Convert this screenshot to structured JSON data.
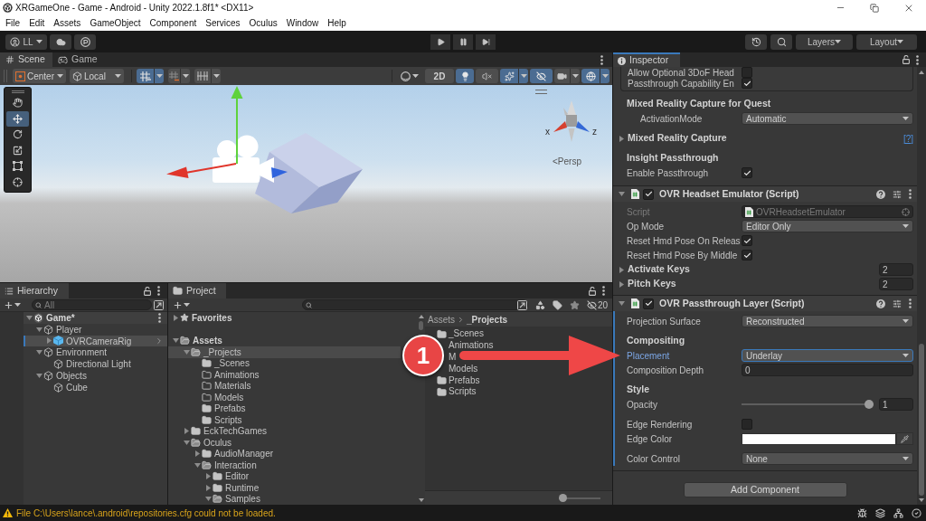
{
  "window": {
    "title": "XRGameOne - Game - Android - Unity 2022.1.8f1* <DX11>"
  },
  "menu": [
    "File",
    "Edit",
    "Assets",
    "GameObject",
    "Component",
    "Services",
    "Oculus",
    "Window",
    "Help"
  ],
  "toolbar": {
    "account": "LL",
    "layers": "Layers",
    "layout": "Layout"
  },
  "scene": {
    "tabs": [
      {
        "label": "Scene",
        "kind": "scene",
        "selected": true
      },
      {
        "label": "Game",
        "kind": "game",
        "selected": false
      }
    ],
    "pivot": "Center",
    "space": "Local",
    "snap_toggles": [
      {
        "kind": "snap",
        "on": true
      },
      {
        "kind": "increment",
        "on": false
      },
      {
        "kind": "grid",
        "on": false
      }
    ],
    "view_toggles": [
      {
        "kind": "dimension",
        "label": "2D",
        "on": false
      },
      {
        "kind": "lighting",
        "on": true
      },
      {
        "kind": "audio",
        "on": false
      },
      {
        "kind": "effects",
        "on": true
      },
      {
        "kind": "visibility",
        "on": true
      },
      {
        "kind": "camera",
        "on": false
      },
      {
        "kind": "gizmos",
        "on": true
      }
    ],
    "tools": [
      {
        "kind": "hand",
        "selected": false
      },
      {
        "kind": "move",
        "selected": true
      },
      {
        "kind": "rotate",
        "selected": false
      },
      {
        "kind": "scale",
        "selected": false
      },
      {
        "kind": "rect",
        "selected": false
      },
      {
        "kind": "transform",
        "selected": false
      }
    ],
    "axis_labels": [
      "x",
      "z"
    ],
    "projection": "<Persp"
  },
  "hierarchy": {
    "title": "Hierarchy",
    "search": {
      "placeholder": "All"
    },
    "tree": [
      {
        "label": "Game*",
        "kind": "scene",
        "expanded": true,
        "selected": false,
        "children": [
          {
            "label": "Player",
            "kind": "object",
            "expanded": true,
            "selected": false,
            "children": [
              {
                "label": "OVRCameraRig",
                "kind": "prefab",
                "expanded": false,
                "selected": true
              }
            ]
          },
          {
            "label": "Environment",
            "kind": "object",
            "expanded": true,
            "selected": false,
            "children": [
              {
                "label": "Directional Light",
                "kind": "object",
                "selected": false
              }
            ]
          },
          {
            "label": "Objects",
            "kind": "object",
            "expanded": true,
            "selected": false,
            "children": [
              {
                "label": "Cube",
                "kind": "object",
                "selected": false
              }
            ]
          }
        ]
      }
    ]
  },
  "project": {
    "title": "Project",
    "hidden_count": "20",
    "tree": [
      {
        "label": "Favorites",
        "kind": "favorites",
        "expanded": false,
        "selected": false
      },
      {
        "label": "Assets",
        "kind": "open_folder",
        "expanded": true,
        "selected": false,
        "children": [
          {
            "label": "_Projects",
            "kind": "open_folder",
            "expanded": true,
            "selected": true,
            "children": [
              {
                "label": "_Scenes",
                "kind": "folder",
                "selected": false
              },
              {
                "label": "Animations",
                "kind": "empty_folder",
                "selected": false
              },
              {
                "label": "Materials",
                "kind": "empty_folder",
                "selected": false
              },
              {
                "label": "Models",
                "kind": "empty_folder",
                "selected": false
              },
              {
                "label": "Prefabs",
                "kind": "folder",
                "selected": false
              },
              {
                "label": "Scripts",
                "kind": "folder",
                "selected": false
              }
            ]
          },
          {
            "label": "EckTechGames",
            "kind": "folder",
            "expanded": false,
            "selected": false
          },
          {
            "label": "Oculus",
            "kind": "open_folder",
            "expanded": true,
            "selected": false,
            "children": [
              {
                "label": "AudioManager",
                "kind": "folder",
                "expanded": false,
                "selected": false
              },
              {
                "label": "Interaction",
                "kind": "open_folder",
                "expanded": true,
                "selected": false,
                "children": [
                  {
                    "label": "Editor",
                    "kind": "folder",
                    "expanded": false,
                    "selected": false
                  },
                  {
                    "label": "Runtime",
                    "kind": "folder",
                    "expanded": false,
                    "selected": false
                  },
                  {
                    "label": "Samples",
                    "kind": "open_folder",
                    "expanded": true,
                    "selected": false
                  }
                ]
              }
            ]
          }
        ]
      }
    ],
    "breadcrumb": [
      "Assets",
      "_Projects"
    ],
    "items": [
      {
        "label": "_Scenes",
        "kind": "folder"
      },
      {
        "label": "Animations",
        "kind": "covered"
      },
      {
        "label": "M",
        "kind": "covered"
      },
      {
        "label": "Models",
        "kind": "covered"
      },
      {
        "label": "Prefabs",
        "kind": "folder"
      },
      {
        "label": "Scripts",
        "kind": "folder"
      }
    ],
    "icon_size": {
      "level": 0
    }
  },
  "inspector": {
    "title": "Inspector",
    "focused": true,
    "box_rows": [
      {
        "kind": "checkbox",
        "label": "Allow Optional 3DoF Head",
        "checked": false
      },
      {
        "kind": "checkbox",
        "label": "Passthrough Capability En",
        "checked": true
      }
    ],
    "sections": [
      {
        "heading": "Mixed Reality Capture for Quest",
        "children": [
          {
            "kind": "dropdown",
            "label": "ActivationMode",
            "value": "Automatic",
            "focused": false
          }
        ]
      },
      {
        "rows": [
          {
            "kind": "foldout",
            "label": "Mixed Reality Capture",
            "expanded": false,
            "help": "[?]"
          }
        ]
      },
      {
        "heading": "Insight Passthrough",
        "rows": [
          {
            "kind": "checkbox",
            "label": "Enable Passthrough",
            "checked": true
          }
        ]
      }
    ],
    "components": [
      {
        "title": "OVR Headset Emulator (Script)",
        "enabled": true,
        "expanded": true,
        "selected": false,
        "sections": [
          {
            "rows": [
              {
                "kind": "object",
                "label": "Script",
                "value": "OVRHeadsetEmulator",
                "disabled": true
              },
              {
                "kind": "dropdown",
                "label": "Op Mode",
                "value": "Editor Only",
                "focused": false
              },
              {
                "kind": "checkbox",
                "label": "Reset Hmd Pose On Releas",
                "checked": true
              },
              {
                "kind": "checkbox",
                "label": "Reset Hmd Pose By Middle",
                "checked": true
              },
              {
                "kind": "foldout",
                "label": "Activate Keys",
                "expanded": false,
                "value": "2"
              },
              {
                "kind": "foldout",
                "label": "Pitch Keys",
                "expanded": false,
                "value": "2"
              }
            ]
          }
        ]
      },
      {
        "title": "OVR Passthrough Layer (Script)",
        "enabled": true,
        "expanded": true,
        "selected": true,
        "sections": [
          {
            "rows": [
              {
                "kind": "dropdown",
                "label": "Projection Surface",
                "value": "Reconstructed",
                "focused": false
              }
            ]
          },
          {
            "heading": "Compositing",
            "rows": [
              {
                "kind": "dropdown",
                "label": "Placement",
                "value": "Underlay",
                "focused": true
              },
              {
                "kind": "number",
                "label": "Composition Depth",
                "value": "0"
              }
            ]
          },
          {
            "heading": "Style",
            "rows": [
              {
                "kind": "slider",
                "label": "Opacity",
                "level": 1,
                "value": "1"
              }
            ]
          },
          {
            "rows": [
              {
                "kind": "checkbox",
                "label": "Edge Rendering",
                "checked": false
              },
              {
                "kind": "color",
                "label": "Edge Color",
                "color": "#ffffff"
              }
            ]
          },
          {
            "rows": [
              {
                "kind": "dropdown",
                "label": "Color Control",
                "value": "None",
                "focused": false
              }
            ]
          }
        ]
      }
    ],
    "add_button": "Add Component"
  },
  "annotation": {
    "label": "1"
  },
  "status": {
    "message": "File C:\\Users\\lance\\.android\\repositories.cfg could not be loaded."
  }
}
